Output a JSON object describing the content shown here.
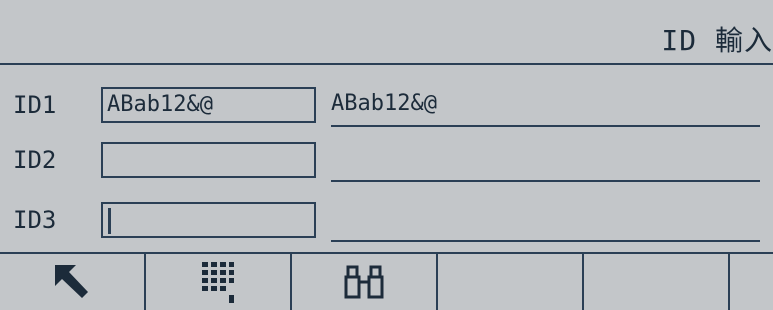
{
  "header": {
    "title": "ID 輸入"
  },
  "fields": [
    {
      "label": "ID1",
      "entry": "ABab12&@",
      "value": "ABab12&@"
    },
    {
      "label": "ID2",
      "entry": "",
      "value": ""
    },
    {
      "label": "ID3",
      "entry": "",
      "value": ""
    }
  ],
  "softkeys": [
    {
      "icon": "exit-arrow-icon"
    },
    {
      "icon": "keypad-icon"
    },
    {
      "icon": "binoculars-icon"
    },
    {
      "icon": ""
    },
    {
      "icon": ""
    },
    {
      "icon": ""
    }
  ],
  "colors": {
    "background": "#c3c6c9",
    "foreground": "#2a3f55"
  }
}
